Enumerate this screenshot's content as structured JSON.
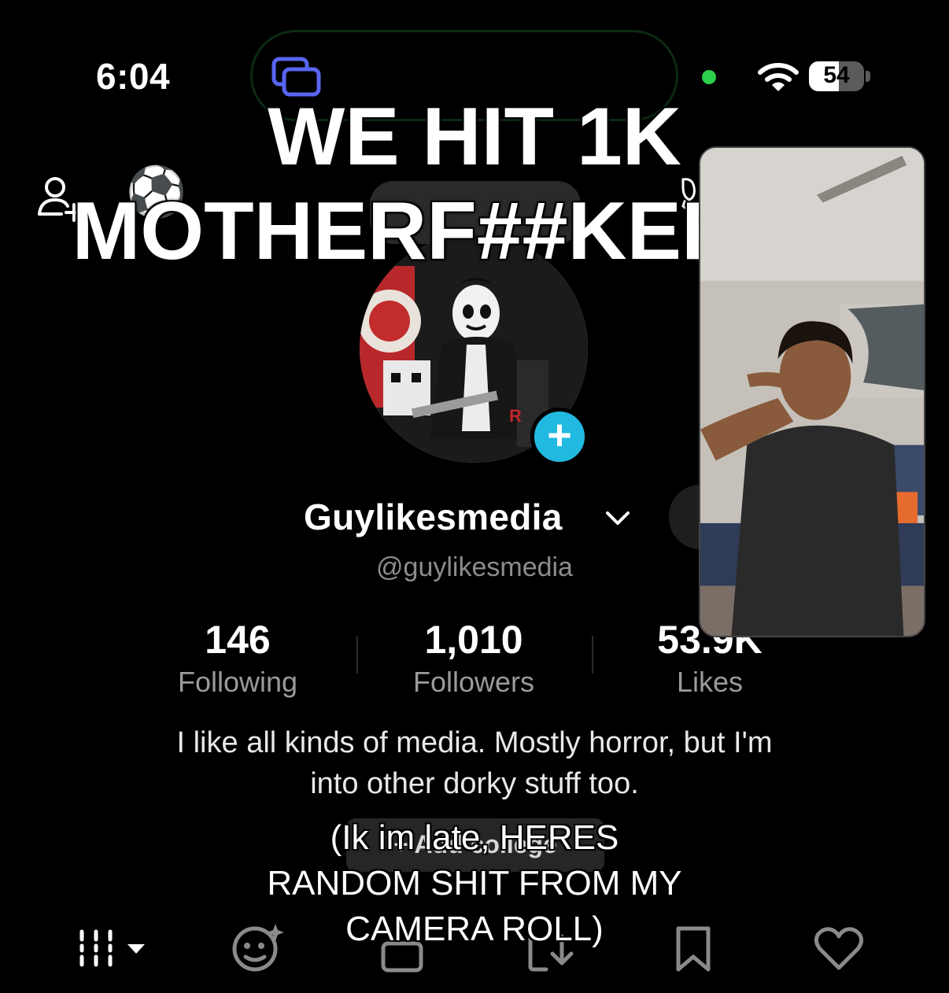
{
  "status_bar": {
    "time": "6:04",
    "battery_level": "54",
    "battery_fraction": 0.54,
    "icons": [
      "screen-mirroring-icon",
      "camera-in-use-dot",
      "wifi-icon",
      "battery-icon"
    ]
  },
  "overlay": {
    "headline_line1": "WE HIT 1K",
    "headline_line2": "MOTHERF##KERS!!!",
    "caption_line1": "(Ik im late, HERES",
    "caption_line2": "RANDOM SHIT FROM MY",
    "caption_line3": "CAMERA ROLL)"
  },
  "profile": {
    "header_emoji": "⚽",
    "display_name": "Guylikesmedia",
    "handle": "@guylikesmedia",
    "stats": [
      {
        "value": "146",
        "label": "Following"
      },
      {
        "value": "1,010",
        "label": "Followers"
      },
      {
        "value": "53.9K",
        "label": "Likes"
      }
    ],
    "bio_line1": "I like all kinds of media. Mostly horror, but I'm",
    "bio_line2": "into other dorky stuff too.",
    "add_college": "+ Add college"
  },
  "tabs": [
    "videos-grid-icon",
    "reposts-icon",
    "private-icon",
    "liked-icon",
    "favorites-icon",
    "liked-heart-icon"
  ],
  "colors": {
    "background": "#000000",
    "accent_blue": "#22b9e0",
    "secondary_text": "#8c8c8c",
    "island_icon": "#5865f2",
    "camera_dot": "#2bd14a"
  }
}
